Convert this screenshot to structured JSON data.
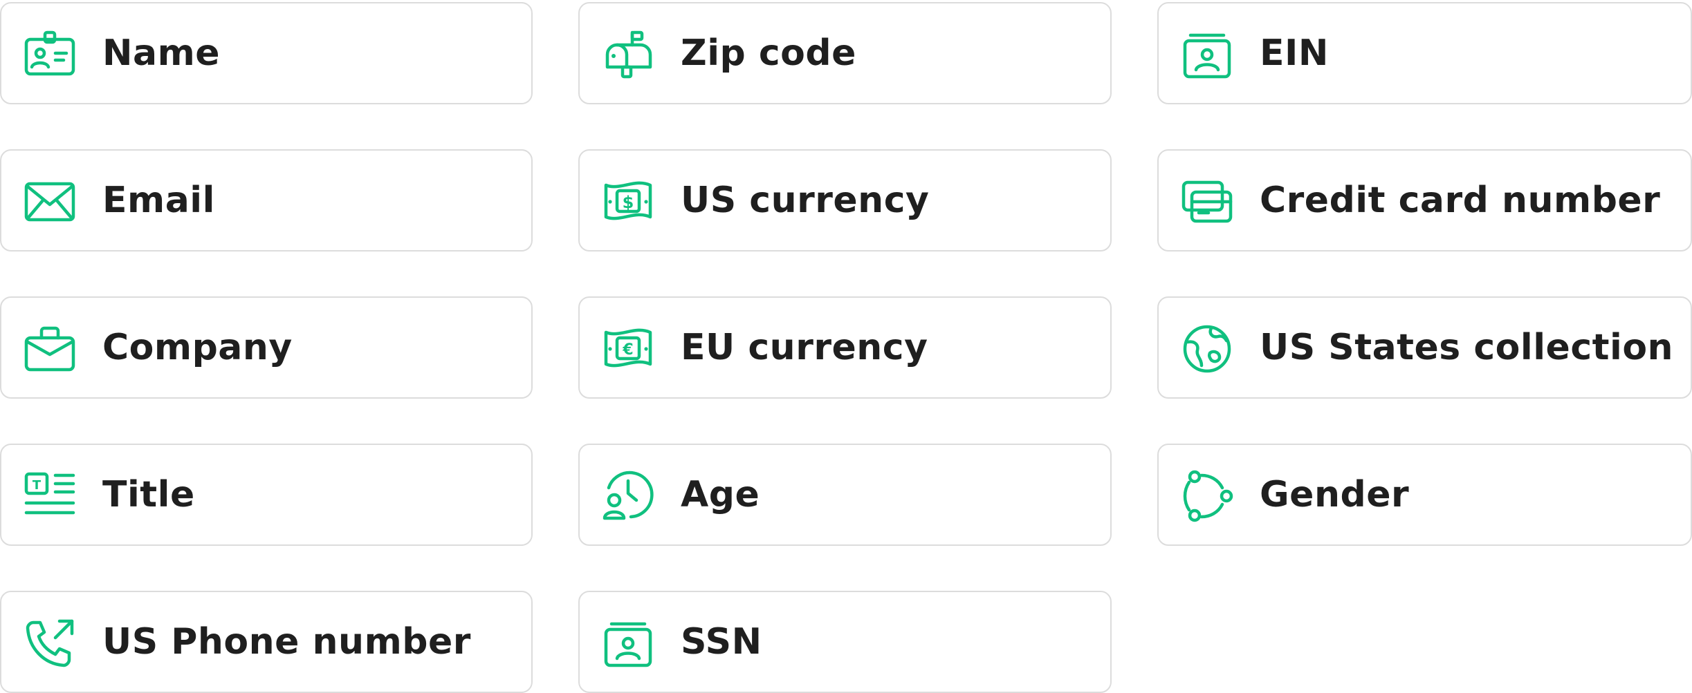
{
  "theme": {
    "accent": "#10c07f",
    "text": "#1f1f1f",
    "border": "#dcdcdc",
    "background": "#ffffff"
  },
  "fields": [
    {
      "id": "name",
      "label": "Name",
      "icon": "id-badge-icon"
    },
    {
      "id": "zip",
      "label": "Zip code",
      "icon": "mailbox-icon"
    },
    {
      "id": "ein",
      "label": "EIN",
      "icon": "id-card-stack-icon"
    },
    {
      "id": "email",
      "label": "Email",
      "icon": "envelope-icon"
    },
    {
      "id": "usd",
      "label": "US currency",
      "icon": "dollar-bill-icon"
    },
    {
      "id": "credit-card",
      "label": "Credit card number",
      "icon": "credit-cards-icon"
    },
    {
      "id": "company",
      "label": "Company",
      "icon": "briefcase-icon"
    },
    {
      "id": "eur",
      "label": "EU currency",
      "icon": "euro-bill-icon"
    },
    {
      "id": "us-states",
      "label": "US States collection",
      "icon": "globe-icon"
    },
    {
      "id": "title",
      "label": "Title",
      "icon": "text-title-icon"
    },
    {
      "id": "age",
      "label": "Age",
      "icon": "user-clock-icon"
    },
    {
      "id": "gender",
      "label": "Gender",
      "icon": "gender-cycle-icon"
    },
    {
      "id": "phone",
      "label": "US Phone number",
      "icon": "phone-outgoing-icon"
    },
    {
      "id": "ssn",
      "label": "SSN",
      "icon": "id-card-stack-icon"
    }
  ]
}
